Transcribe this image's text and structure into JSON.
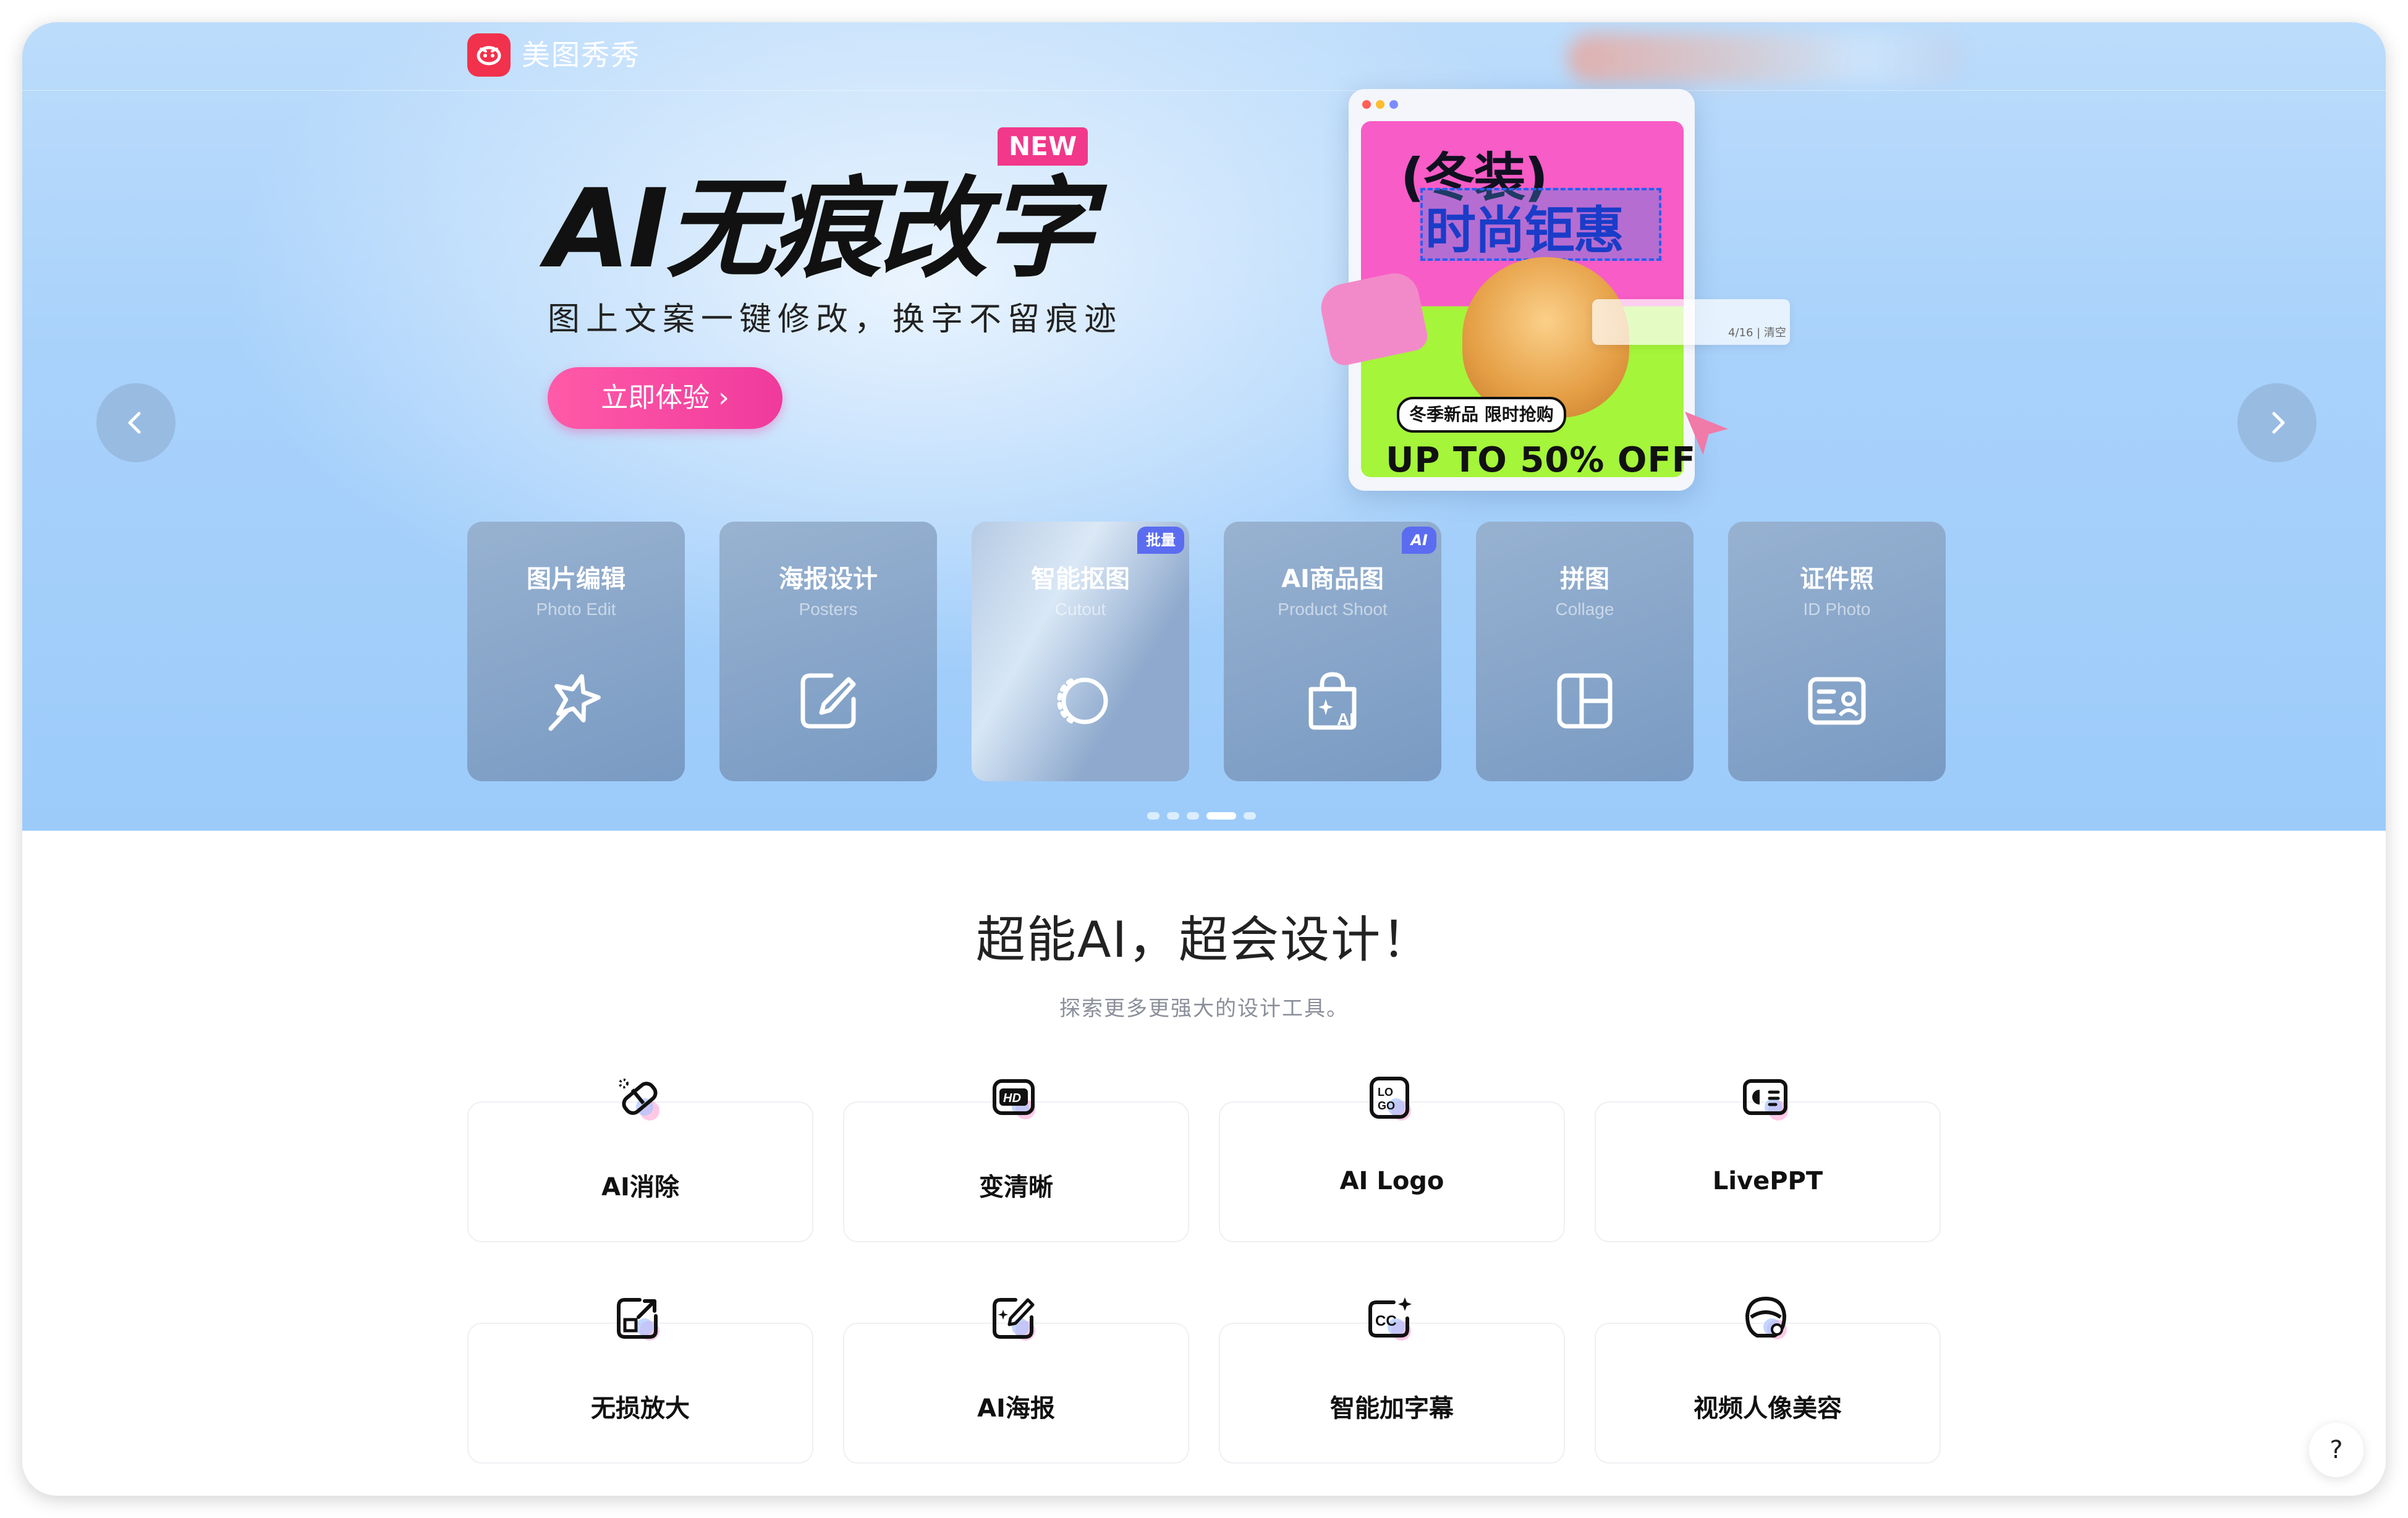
{
  "header": {
    "app_name": "美图秀秀"
  },
  "hero": {
    "title": "AI无痕改字",
    "badge": "NEW",
    "subtitle": "图上文案一键修改，换字不留痕迹",
    "cta_label": "立即体验 ›",
    "poster": {
      "headline_1": "(冬装)",
      "headline_2": "时尚钜惠",
      "tag": "冬季新品 限时抢购",
      "offer": "UP TO 50% OFF",
      "counter": "4/16 | 清空"
    }
  },
  "tools": [
    {
      "title": "图片编辑",
      "subtitle": "Photo Edit",
      "icon": "magic-wand-icon",
      "badge": ""
    },
    {
      "title": "海报设计",
      "subtitle": "Posters",
      "icon": "edit-square-icon",
      "badge": ""
    },
    {
      "title": "智能抠图",
      "subtitle": "Cutout",
      "icon": "cutout-circle-icon",
      "badge": "批量"
    },
    {
      "title": "AI商品图",
      "subtitle": "Product Shoot",
      "icon": "ai-bag-icon",
      "badge": "AI"
    },
    {
      "title": "拼图",
      "subtitle": "Collage",
      "icon": "collage-grid-icon",
      "badge": ""
    },
    {
      "title": "证件照",
      "subtitle": "ID Photo",
      "icon": "id-card-icon",
      "badge": ""
    }
  ],
  "carousel": {
    "page_count": 5,
    "active_index": 3
  },
  "features_section": {
    "title": "超能AI，超会设计！",
    "subtitle": "探索更多更强大的设计工具。",
    "items": [
      {
        "label": "AI消除",
        "icon": "eraser-icon"
      },
      {
        "label": "变清晰",
        "icon": "hd-icon"
      },
      {
        "label": "AI Logo",
        "icon": "logo-icon"
      },
      {
        "label": "LivePPT",
        "icon": "ppt-icon"
      },
      {
        "label": "无损放大",
        "icon": "upscale-icon"
      },
      {
        "label": "AI海报",
        "icon": "ai-poster-icon"
      },
      {
        "label": "智能加字幕",
        "icon": "subtitle-cc-icon"
      },
      {
        "label": "视频人像美容",
        "icon": "video-beauty-icon"
      }
    ]
  },
  "help": {
    "label": "?"
  },
  "colors": {
    "brand_red": "#f2314c",
    "cta_pink": "#f03a9c",
    "badge_blue": "#5b6cf0",
    "badge_pink": "#f1388a"
  }
}
